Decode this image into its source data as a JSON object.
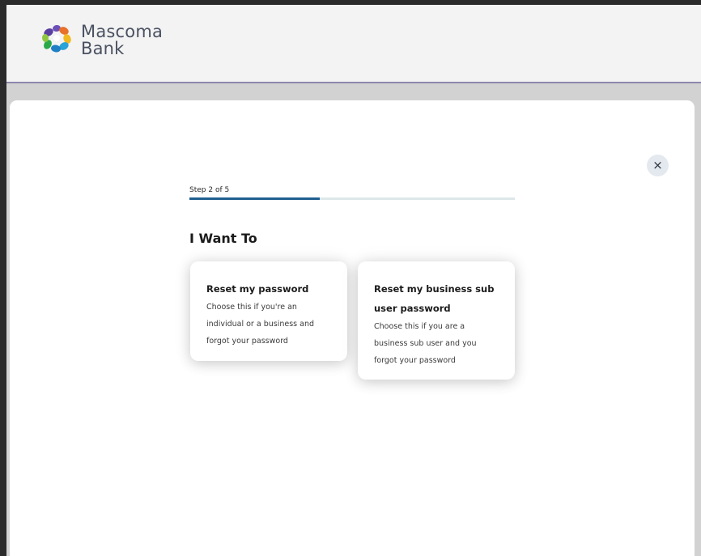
{
  "brand": {
    "name_line1": "Mascoma",
    "name_line2": "Bank",
    "colors": [
      "#5a3fa0",
      "#e8702a",
      "#f2b820",
      "#2aa84a",
      "#1f7fc4",
      "#8fc640"
    ]
  },
  "modal": {
    "close_label": "×",
    "step_label": "Step 2 of 5",
    "progress": 0.4,
    "heading": "I Want To",
    "options": [
      {
        "title": "Reset my password",
        "description": "Choose this if you're an individual or a business and forgot your password"
      },
      {
        "title": "Reset my business sub user password",
        "description": "Choose this if you are a business sub user and you forgot your password"
      }
    ]
  },
  "colors": {
    "progress_fill": "#1f5f90",
    "progress_track": "#dde7e9",
    "header_border": "#8e86ad"
  }
}
